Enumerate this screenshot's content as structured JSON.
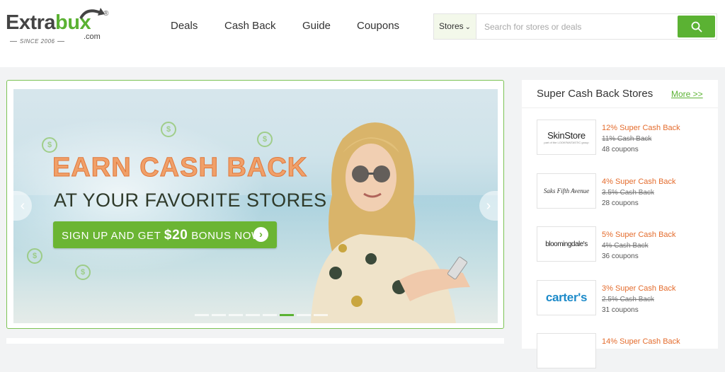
{
  "logo": {
    "brand_main": "Extra",
    "brand_accent": "bux",
    "reg": "®",
    "dotcom": ".com",
    "since": "SINCE 2006"
  },
  "nav": [
    {
      "label": "Deals"
    },
    {
      "label": "Cash Back"
    },
    {
      "label": "Guide"
    },
    {
      "label": "Coupons"
    }
  ],
  "search": {
    "scope": "Stores",
    "placeholder": "Search for stores or deals",
    "button_icon": "search-icon"
  },
  "banner": {
    "headline": "EARN CASH BACK",
    "subheadline": "AT YOUR FAVORITE STORES",
    "cta_before": "SIGN UP AND GET ",
    "cta_amount": "$20",
    "cta_after": " BONUS NOW!",
    "slide_count": 8,
    "active_slide": 6
  },
  "super_stores": {
    "title": "Super Cash Back Stores",
    "more": "More >>",
    "items": [
      {
        "logo_text": "SkinStore",
        "logo_sub": "part of the LOOKFANTASTIC group",
        "rate": "12% Super Cash Back",
        "old_rate": "11% Cash Back",
        "coupons": "48 coupons"
      },
      {
        "logo_text": "Saks Fifth Avenue",
        "rate": "4% Super Cash Back",
        "old_rate": "3.5% Cash Back",
        "coupons": "28 coupons"
      },
      {
        "logo_text": "bloomingdale's",
        "rate": "5% Super Cash Back",
        "old_rate": "4% Cash Back",
        "coupons": "36 coupons"
      },
      {
        "logo_text": "carter's",
        "rate": "3% Super Cash Back",
        "old_rate": "2.5% Cash Back",
        "coupons": "31 coupons"
      },
      {
        "logo_text": "",
        "rate": "14% Super Cash Back",
        "old_rate": "",
        "coupons": ""
      }
    ]
  },
  "colors": {
    "brand_green": "#5bb233",
    "accent_orange": "#e46c2d",
    "headline_orange": "#f0a069"
  }
}
